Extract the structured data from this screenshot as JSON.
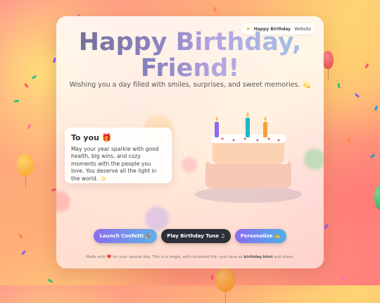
{
  "badge": {
    "brand": "Happy Birthday",
    "link": "Website",
    "icon": "star-icon"
  },
  "title": {
    "line1": "Happy Birthday,",
    "line2": "Friend!"
  },
  "subtitle": "Wishing you a day filled with smiles, surprises, and sweet memories. 💫",
  "note": {
    "heading": "To you 🎁",
    "body": "May your year sparkle with good health, big wins, and cozy moments with the people you love. You deserve all the light in the world. ✨"
  },
  "cake": {
    "candles": 3,
    "candle_colors": [
      "#8b6cf0",
      "#1fb6c9",
      "#f2a23a"
    ],
    "icon": "birthday-cake-icon"
  },
  "actions": {
    "confetti_label": "Launch Confetti 🎉",
    "tune_label": "Play Birthday Tune ♫",
    "personalize_label": "Personalize ✍️"
  },
  "footer": {
    "prefix": "Made with ❤️ for your special day. This is a single, self-contained file—just save as ",
    "filename": "birthday.html",
    "suffix": " and share."
  },
  "colors": {
    "accent_purple": "#8a6cf0",
    "accent_blue": "#5fb3e8",
    "dark_button": "#2d2f38"
  }
}
